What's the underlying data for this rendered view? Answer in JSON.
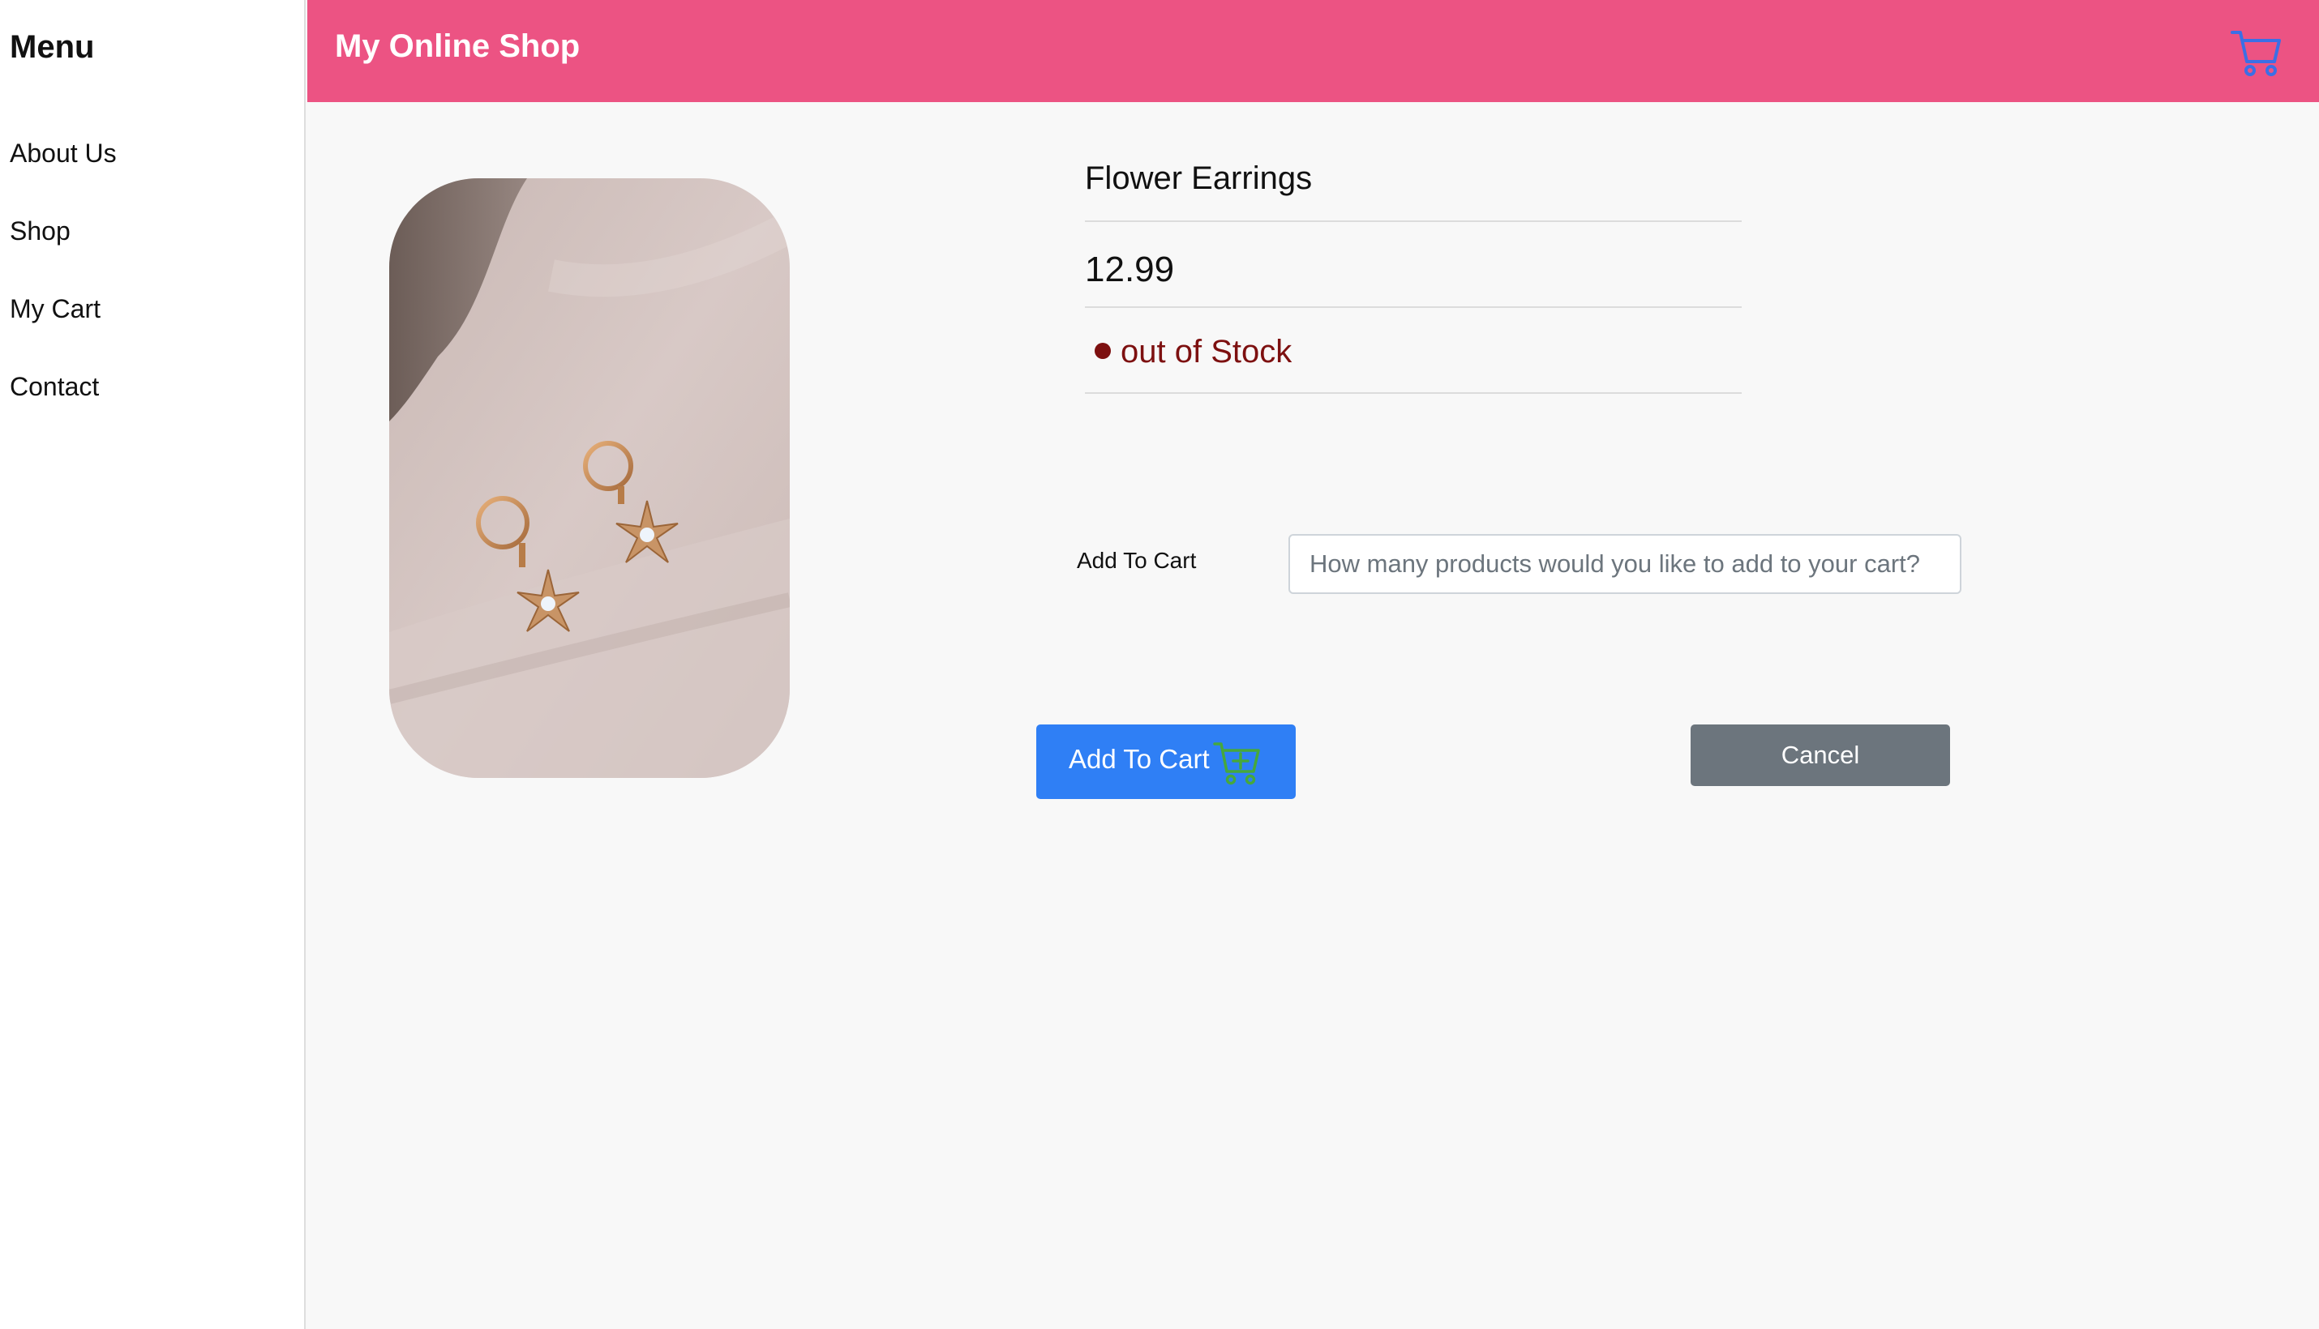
{
  "sidebar": {
    "title": "Menu",
    "items": [
      {
        "label": "About Us"
      },
      {
        "label": "Shop"
      },
      {
        "label": "My Cart"
      },
      {
        "label": "Contact"
      }
    ]
  },
  "header": {
    "title": "My Online Shop",
    "cart_icon": "shopping-cart-icon",
    "accent_color": "#ec5383",
    "cart_icon_color": "#3b6fe6"
  },
  "product": {
    "name": "Flower Earrings",
    "price": "12.99",
    "stock_status": "out of Stock",
    "stock_color": "#7d1010",
    "image": "earrings-photo"
  },
  "form": {
    "quantity_label": "Add To Cart",
    "quantity_placeholder": "How many products would you like to add to your cart?"
  },
  "actions": {
    "add_label": "Add To Cart",
    "add_icon": "cart-plus-icon",
    "add_color": "#2f7ff5",
    "cancel_label": "Cancel",
    "cancel_color": "#6c757d"
  }
}
